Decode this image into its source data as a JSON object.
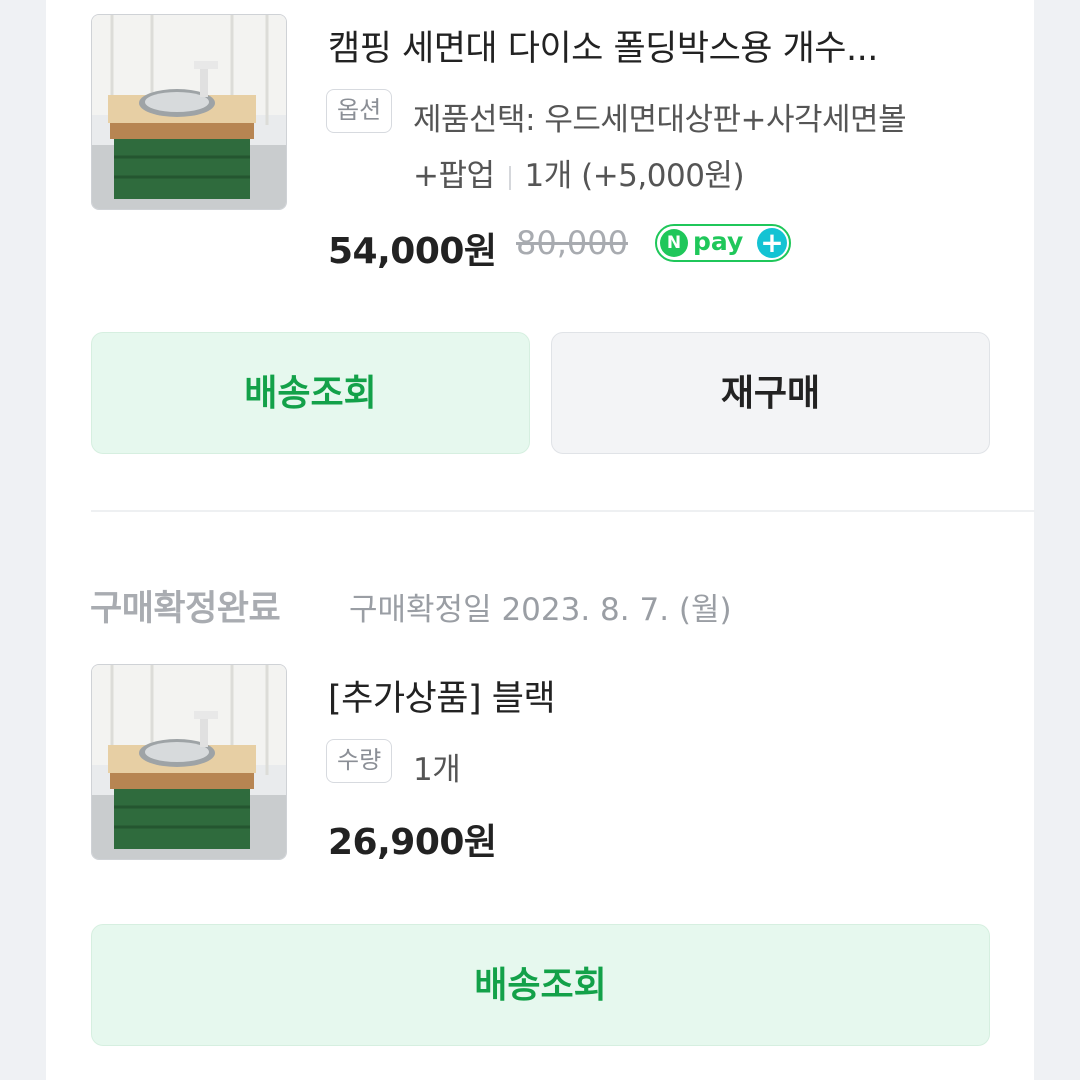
{
  "items": [
    {
      "title": "캠핑 세면대 다이소 폴딩박스용 개수...",
      "option_tag": "옵션",
      "option_line1": "제품선택: 우드세면대상판+사각세면볼",
      "option_line2": "+팝업",
      "option_qty": "1개 (+5,000원)",
      "price": "54,000원",
      "original_price": "80,000",
      "npay": {
        "n": "N",
        "label": "pay",
        "plus": "+"
      },
      "buttons": {
        "track": "배송조회",
        "rebuy": "재구매"
      },
      "thumb_icon": "camping-sink-thumbnail"
    },
    {
      "status": "구매확정완료",
      "status_date": "구매확정일 2023. 8. 7. (월)",
      "title": "[추가상품] 블랙",
      "qty_tag": "수량",
      "qty": "1개",
      "price": "26,900원",
      "buttons": {
        "track": "배송조회"
      },
      "thumb_icon": "camping-sink-thumbnail"
    }
  ],
  "colors": {
    "accent_green": "#13a149",
    "button_green_bg": "#e6f8ee",
    "npay_green": "#1fc75a",
    "npay_plus": "#14c3d3",
    "page_bg": "#eff1f4"
  }
}
